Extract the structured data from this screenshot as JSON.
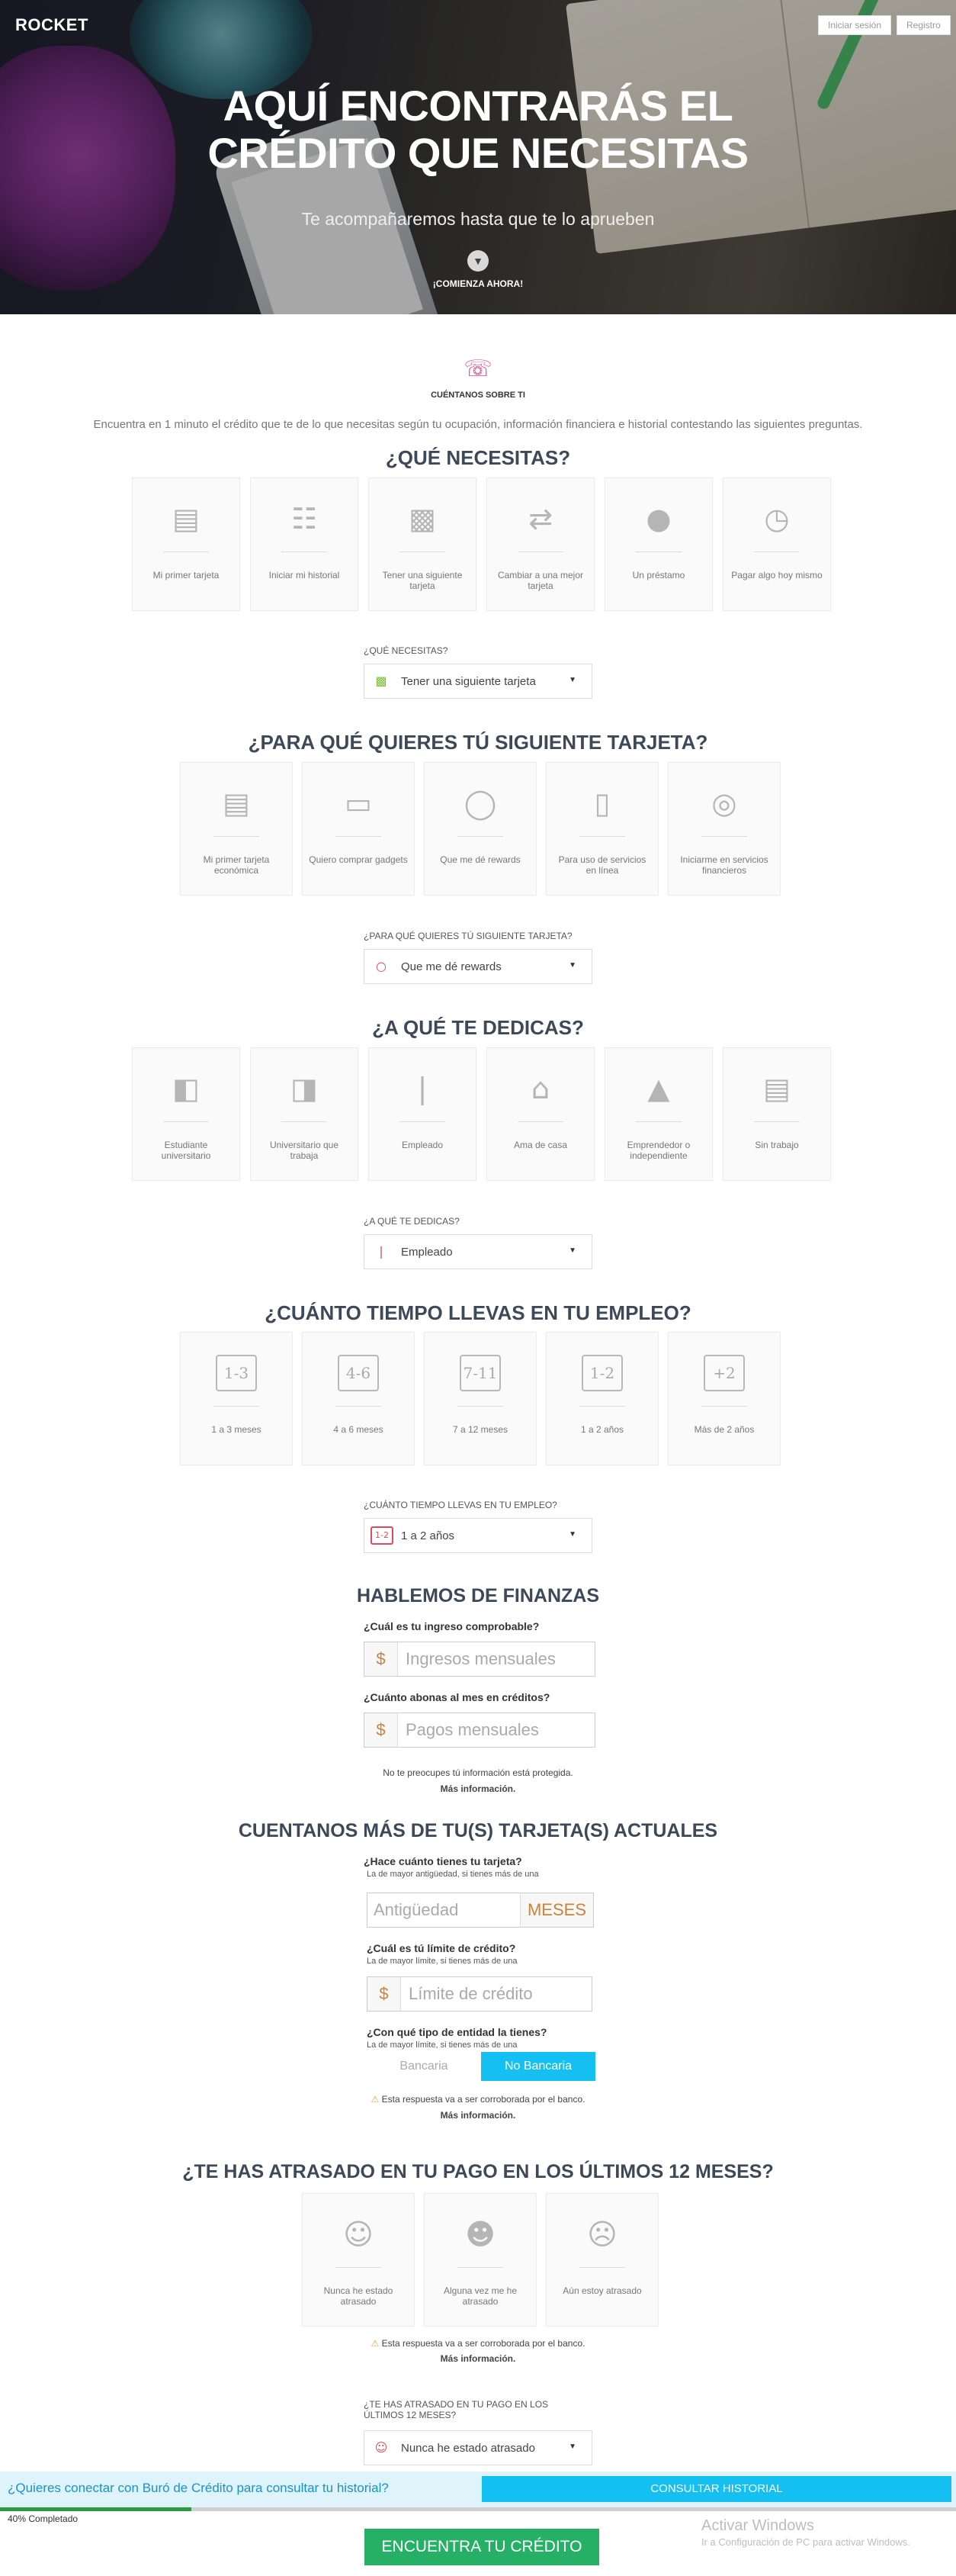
{
  "header": {
    "logo": "ROCKET",
    "login": "Iniciar sesión",
    "register": "Registro"
  },
  "hero": {
    "title_line1": "AQUÍ ENCONTRARÁS EL",
    "title_line2": "CRÉDITO QUE NECESITAS",
    "subtitle": "Te acompañaremos hasta que te lo aprueben",
    "cta": "¡COMIENZA AHORA!"
  },
  "intro": {
    "kicker": "CUÉNTANOS SOBRE TI",
    "text": "Encuentra en 1 minuto el crédito que te de lo que necesitas según tu ocupación, información financiera e historial contestando las siguientes preguntas."
  },
  "q1": {
    "title": "¿QUÉ NECESITAS?",
    "options": [
      {
        "label": "Mi primer tarjeta",
        "icon": "card-icon"
      },
      {
        "label": "Iniciar mi historial",
        "icon": "document-dollar-icon"
      },
      {
        "label": "Tener una siguiente tarjeta",
        "icon": "two-cards-icon"
      },
      {
        "label": "Cambiar a una mejor tarjeta",
        "icon": "swap-cards-icon"
      },
      {
        "label": "Un préstamo",
        "icon": "money-bag-icon"
      },
      {
        "label": "Pagar algo hoy mismo",
        "icon": "stopwatch-icon"
      }
    ],
    "select_label": "¿QUÉ NECESITAS?",
    "selected": "Tener una siguiente tarjeta"
  },
  "q2": {
    "title": "¿PARA QUÉ QUIERES TÚ SIGUIENTE TARJETA?",
    "options": [
      {
        "label": "Mi primer tarjeta económica",
        "icon": "card-discount-icon"
      },
      {
        "label": "Quiero comprar gadgets",
        "icon": "gadget-card-icon"
      },
      {
        "label": "Que me dé rewards",
        "icon": "piggy-bank-icon"
      },
      {
        "label": "Para uso de servicios en línea",
        "icon": "mouse-icon"
      },
      {
        "label": "Iniciarme en servicios financieros",
        "icon": "coins-icon"
      }
    ],
    "select_label": "¿PARA QUÉ QUIERES TÚ SIGUIENTE TARJETA?",
    "selected": "Que me dé rewards"
  },
  "q3": {
    "title": "¿A QUÉ TE DEDICAS?",
    "options": [
      {
        "label": "Estudiante universitario",
        "icon": "book-icon"
      },
      {
        "label": "Universitario que trabaja",
        "icon": "book-tie-icon"
      },
      {
        "label": "Empleado",
        "icon": "tie-icon"
      },
      {
        "label": "Ama de casa",
        "icon": "house-icon"
      },
      {
        "label": "Emprendedor o independiente",
        "icon": "mountain-icon"
      },
      {
        "label": "Sin trabajo",
        "icon": "newspaper-icon"
      }
    ],
    "select_label": "¿A QUÉ TE DEDICAS?",
    "selected": "Empleado"
  },
  "q4": {
    "title": "¿CUÁNTO TIEMPO LLEVAS EN TU EMPLEO?",
    "options": [
      {
        "label": "1 a 3 meses",
        "icon_text": "1-3"
      },
      {
        "label": "4 a 6 meses",
        "icon_text": "4-6"
      },
      {
        "label": "7 a 12 meses",
        "icon_text": "7-11"
      },
      {
        "label": "1 a 2 años",
        "icon_text": "1-2"
      },
      {
        "label": "Más de 2 años",
        "icon_text": "+2"
      }
    ],
    "select_label": "¿CUÁNTO TIEMPO LLEVAS EN TU EMPLEO?",
    "selected": "1 a 2 años",
    "selected_icon_text": "1-2"
  },
  "finanzas": {
    "title": "HABLEMOS DE FINANZAS",
    "income_label": "¿Cuál es tu ingreso comprobable?",
    "income_placeholder": "Ingresos mensuales",
    "payments_label": "¿Cuánto abonas al mes en créditos?",
    "payments_placeholder": "Pagos mensuales",
    "currency": "$",
    "note": "No te preocupes tú información está protegida.",
    "more": "Más información."
  },
  "tarjetas": {
    "title": "CUENTANOS MÁS DE TU(S) TARJETA(S) ACTUALES",
    "age_label": "¿Hace cuánto tienes tu tarjeta?",
    "age_sub": "La de mayor antigüedad, si tienes más de una",
    "age_placeholder": "Antigüedad",
    "age_unit": "MESES",
    "limit_label": "¿Cuál es tú límite de crédito?",
    "limit_sub": "La de mayor límite, si tienes más de una",
    "limit_placeholder": "Límite de crédito",
    "entity_label": "¿Con qué tipo de entidad la tienes?",
    "entity_sub": "La de mayor límite, si tienes más de una",
    "entity_options": [
      "Bancaria",
      "No Bancaria"
    ],
    "entity_selected": "No Bancaria",
    "warn": "Esta respuesta va a ser corroborada por el banco.",
    "more": "Más información."
  },
  "atrasos": {
    "title": "¿TE HAS ATRASADO EN TU PAGO EN LOS ÚLTIMOS 12 MESES?",
    "options": [
      {
        "label": "Nunca he estado atrasado",
        "icon": "happy-face-icon"
      },
      {
        "label": "Alguna vez me he atrasado",
        "icon": "neutral-face-icon"
      },
      {
        "label": "Aún estoy atrasado",
        "icon": "sad-face-icon"
      }
    ],
    "warn": "Esta respuesta va a ser corroborada por el banco.",
    "more": "Más información.",
    "select_label": "¿TE HAS ATRASADO EN TU PAGO EN LOS ÚLTIMOS 12 MESES?",
    "selected": "Nunca he estado atrasado"
  },
  "buro": {
    "question": "¿Quieres conectar con Buró de Crédito para consultar tu historial?",
    "button": "CONSULTAR HISTORIAL"
  },
  "progress": {
    "percent": 40,
    "label": "40% Completado"
  },
  "cta": "ENCUENTRA TU CRÉDITO",
  "watermark": {
    "line1": "Activar Windows",
    "line2": "Ir a Configuración de PC para activar Windows."
  },
  "colors": {
    "accent_blue": "#14bff2",
    "green": "#26b065",
    "heading": "#3d4859",
    "currency_orange": "#c8843a"
  }
}
